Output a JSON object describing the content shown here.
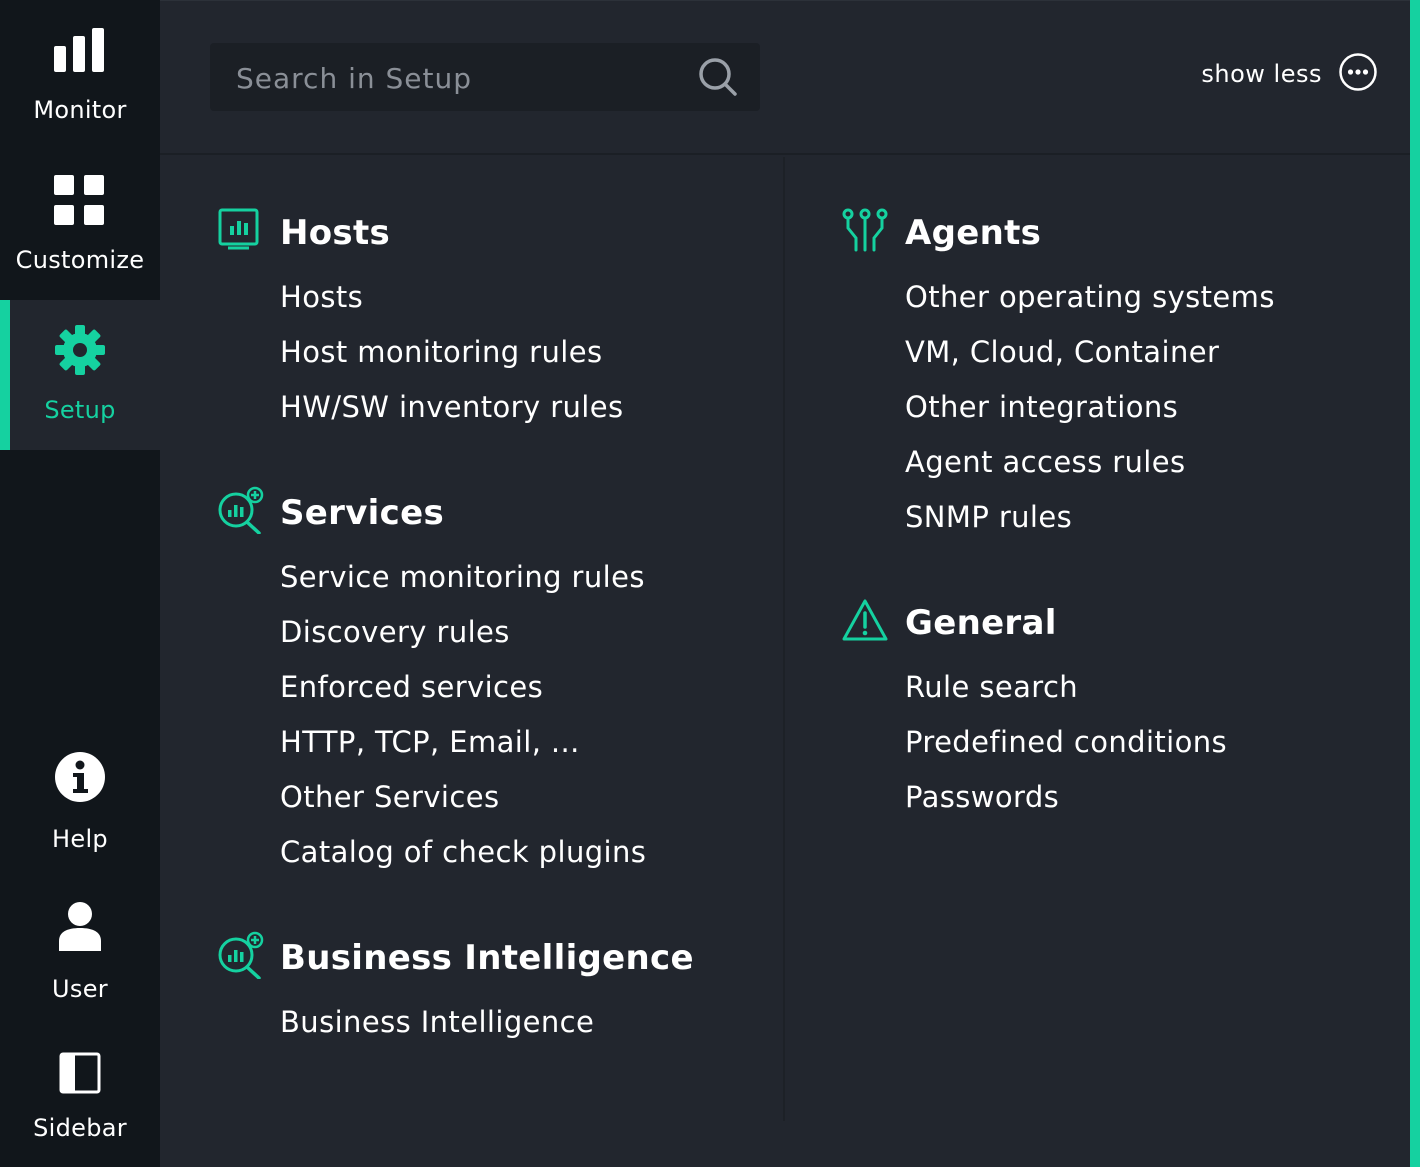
{
  "nav": {
    "monitor": "Monitor",
    "customize": "Customize",
    "setup": "Setup",
    "help": "Help",
    "user": "User",
    "sidebar": "Sidebar"
  },
  "search": {
    "placeholder": "Search in Setup"
  },
  "header": {
    "show_less": "show less"
  },
  "colors": {
    "accent": "#15d1a0",
    "panel_bg": "#22262e",
    "nav_bg": "#11161b"
  },
  "sections": {
    "hosts": {
      "title": "Hosts",
      "items": [
        "Hosts",
        "Host monitoring rules",
        "HW/SW inventory rules"
      ]
    },
    "services": {
      "title": "Services",
      "items": [
        "Service monitoring rules",
        "Discovery rules",
        "Enforced services",
        "HTTP, TCP, Email, ...",
        "Other Services",
        "Catalog of check plugins"
      ]
    },
    "bi": {
      "title": "Business Intelligence",
      "items": [
        "Business Intelligence"
      ]
    },
    "agents": {
      "title": "Agents",
      "items": [
        "Other operating systems",
        "VM, Cloud, Container",
        "Other integrations",
        "Agent access rules",
        "SNMP rules"
      ]
    },
    "general": {
      "title": "General",
      "items": [
        "Rule search",
        "Predefined conditions",
        "Passwords"
      ]
    }
  }
}
